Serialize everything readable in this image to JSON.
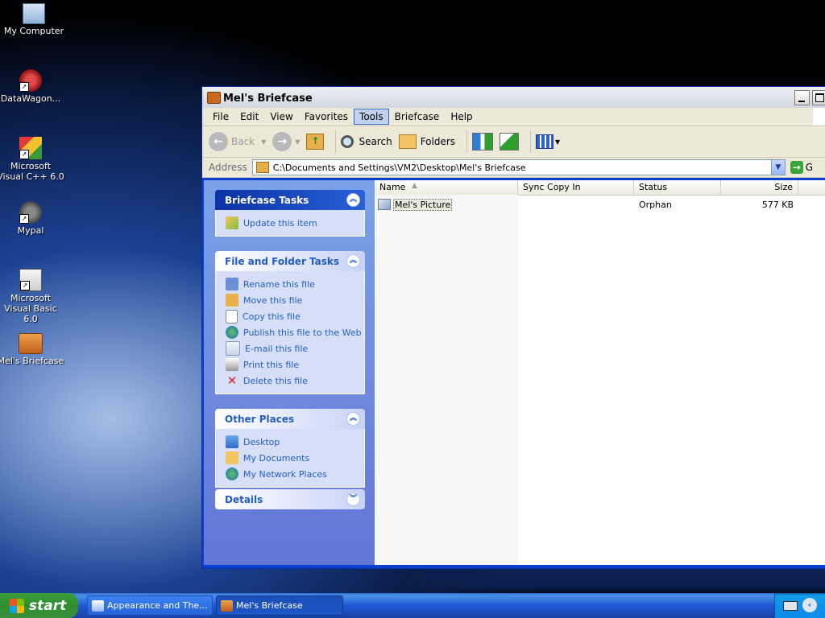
{
  "desktop": {
    "icons": [
      {
        "label": "My Computer",
        "icon": "computer-icon"
      },
      {
        "label": "DataWagon...",
        "icon": "datawagon-icon"
      },
      {
        "label": "Microsoft Visual C++ 6.0",
        "icon": "visual-cpp-icon"
      },
      {
        "label": "Mypal",
        "icon": "mypal-icon"
      },
      {
        "label": "Microsoft Visual Basic 6.0",
        "icon": "visual-basic-icon"
      },
      {
        "label": "Mel's Briefcase",
        "icon": "briefcase-icon"
      }
    ]
  },
  "window": {
    "title": "Mel's Briefcase",
    "menu": [
      "File",
      "Edit",
      "View",
      "Favorites",
      "Tools",
      "Briefcase",
      "Help"
    ],
    "active_menu": "Tools",
    "toolbar": {
      "back": "Back",
      "search": "Search",
      "folders": "Folders"
    },
    "address": {
      "label": "Address",
      "value": "C:\\Documents and Settings\\VM2\\Desktop\\Mel's Briefcase",
      "go": "G"
    },
    "tasks": {
      "briefcase": {
        "title": "Briefcase Tasks",
        "items": [
          "Update this item"
        ]
      },
      "file_folder": {
        "title": "File and Folder Tasks",
        "items": [
          "Rename this file",
          "Move this file",
          "Copy this file",
          "Publish this file to the Web",
          "E-mail this file",
          "Print this file",
          "Delete this file"
        ]
      },
      "other_places": {
        "title": "Other Places",
        "items": [
          "Desktop",
          "My Documents",
          "My Network Places"
        ]
      },
      "details": {
        "title": "Details"
      }
    },
    "list": {
      "columns": [
        "Name",
        "Sync Copy In",
        "Status",
        "Size"
      ],
      "rows": [
        {
          "name": "Mel's Picture",
          "sync": "",
          "status": "Orphan",
          "size": "577 KB"
        }
      ]
    }
  },
  "taskbar": {
    "start": "start",
    "tasks": [
      "Appearance and The...",
      "Mel's Briefcase"
    ]
  },
  "colors": {
    "title_active": "#e0e4ea",
    "taskpane": "#6b8ee0",
    "link": "#215dc6",
    "taskbar": "#245edb",
    "start_green": "#3a9a3a"
  }
}
